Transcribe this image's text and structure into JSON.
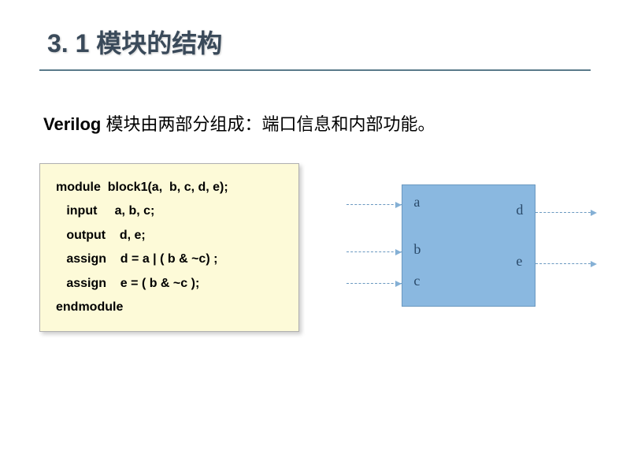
{
  "title": "3. 1  模块的结构",
  "description": {
    "prefix": "Verilog",
    "text": " 模块由两部分组成：端口信息和内部功能。"
  },
  "code": {
    "line1": "module  block1(a,  b, c, d, e);",
    "line2": "   input     a, b, c;",
    "line3": "   output    d, e;",
    "line4": "",
    "line5": "   assign    d = a | ( b & ~c) ;",
    "line6": "   assign    e = ( b & ~c );",
    "line7": "",
    "line8": "endmodule"
  },
  "diagram": {
    "ports": {
      "a": "a",
      "b": "b",
      "c": "c",
      "d": "d",
      "e": "e"
    }
  }
}
